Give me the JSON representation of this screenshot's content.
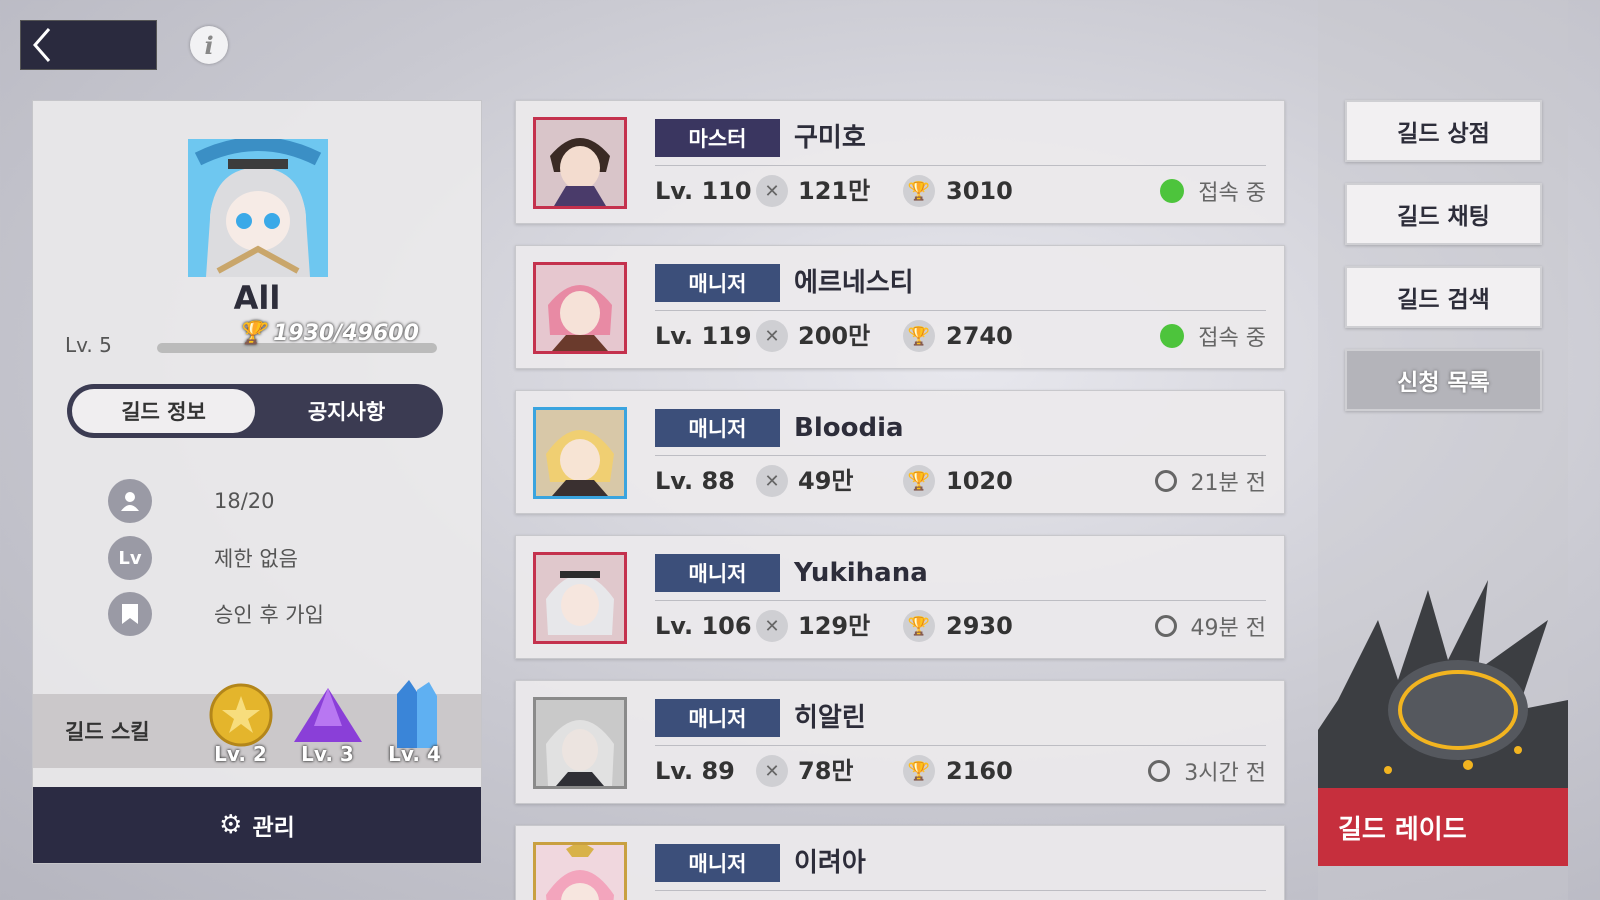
{
  "header": {
    "back_icon": "chevron-left-icon",
    "info_label": "i"
  },
  "guild": {
    "name": "All",
    "level": "Lv. 5",
    "exp": "1930/49600",
    "exp_fraction": 0.039,
    "tabs": [
      {
        "label": "길드 정보",
        "active": true
      },
      {
        "label": "공지사항",
        "active": false
      }
    ],
    "members_count": "18/20",
    "level_limit": "제한 없음",
    "join_type": "승인 후 가입",
    "skill_title": "길드 스킬",
    "skills": [
      {
        "icon": "gold-medal-icon",
        "level": "Lv. 2"
      },
      {
        "icon": "purple-crystal-icon",
        "level": "Lv. 3"
      },
      {
        "icon": "blue-crystal-icon",
        "level": "Lv. 4"
      }
    ],
    "manage_label": "관리"
  },
  "members": [
    {
      "role": "마스터",
      "name": "구미호",
      "level": "Lv. 110",
      "power": "121만",
      "trophy": "3010",
      "status": "접속 중",
      "online": true
    },
    {
      "role": "매니저",
      "name": "에르네스티",
      "level": "Lv. 119",
      "power": "200만",
      "trophy": "2740",
      "status": "접속 중",
      "online": true
    },
    {
      "role": "매니저",
      "name": "Bloodia",
      "level": "Lv. 88",
      "power": "49만",
      "trophy": "1020",
      "status": "21분 전",
      "online": false
    },
    {
      "role": "매니저",
      "name": "Yukihana",
      "level": "Lv. 106",
      "power": "129만",
      "trophy": "2930",
      "status": "49분 전",
      "online": false
    },
    {
      "role": "매니저",
      "name": "히알린",
      "level": "Lv. 89",
      "power": "78만",
      "trophy": "2160",
      "status": "3시간 전",
      "online": false
    },
    {
      "role": "매니저",
      "name": "이려아",
      "level": "",
      "power": "",
      "trophy": "",
      "status": "",
      "online": false
    }
  ],
  "side_buttons": [
    "길드 상점",
    "길드 채팅",
    "길드 검색",
    "신청 목록"
  ],
  "raid_label": "길드 레이드",
  "colors": {
    "master_badge": "#3a3660",
    "manager_badge": "#3c4f7a",
    "online": "#4dc43c",
    "raid": "#c62f3d",
    "panel_dark": "#2b2b43"
  }
}
